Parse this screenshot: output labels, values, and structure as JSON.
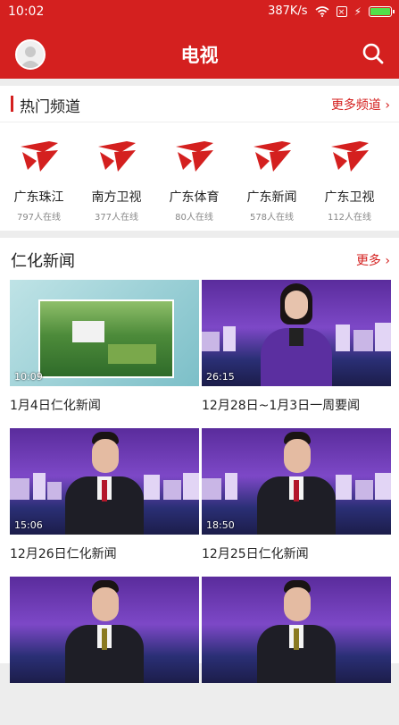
{
  "status": {
    "time": "10:02",
    "speed": "387K/s"
  },
  "header": {
    "title": "电视"
  },
  "hot": {
    "title": "热门频道",
    "more": "更多频道",
    "channels": [
      {
        "name": "广东珠江",
        "count": "797人在线"
      },
      {
        "name": "南方卫视",
        "count": "377人在线"
      },
      {
        "name": "广东体育",
        "count": "80人在线"
      },
      {
        "name": "广东新闻",
        "count": "578人在线"
      },
      {
        "name": "广东卫视",
        "count": "112人在线"
      }
    ]
  },
  "news": {
    "title": "仁化新闻",
    "more": "更多",
    "items": [
      {
        "duration": "10:09",
        "caption": "1月4日仁化新闻"
      },
      {
        "duration": "26:15",
        "caption": "12月28日~1月3日一周要闻"
      },
      {
        "duration": "15:06",
        "caption": "12月26日仁化新闻"
      },
      {
        "duration": "18:50",
        "caption": "12月25日仁化新闻"
      },
      {
        "duration": "",
        "caption": ""
      },
      {
        "duration": "",
        "caption": ""
      }
    ]
  },
  "colors": {
    "accent": "#d4201f",
    "battery": "#52e04a"
  }
}
